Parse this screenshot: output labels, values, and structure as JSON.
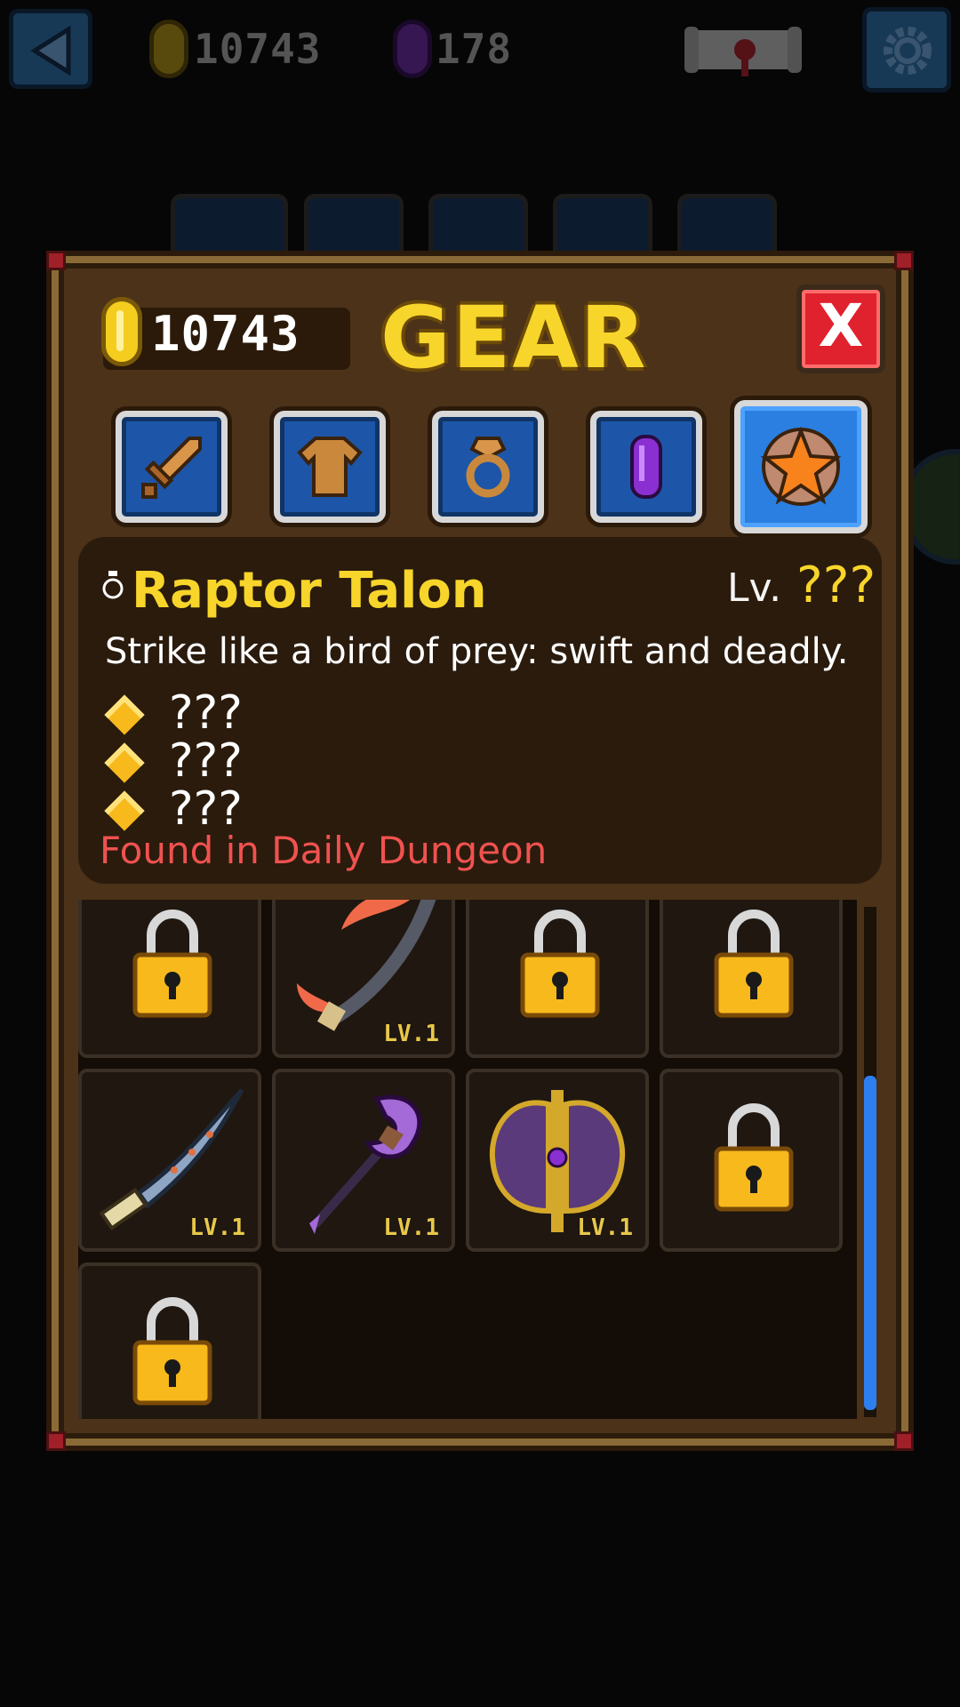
{
  "top_bar": {
    "coins": "10743",
    "gems": "178"
  },
  "gear_panel": {
    "coins": "10743",
    "title": "GEAR",
    "close_label": "X",
    "categories": [
      {
        "name": "weapons",
        "icon": "sword-icon",
        "active": false
      },
      {
        "name": "armor",
        "icon": "shirt-icon",
        "active": false
      },
      {
        "name": "rings",
        "icon": "ring-icon",
        "active": false
      },
      {
        "name": "gems",
        "icon": "gem-icon",
        "active": false
      },
      {
        "name": "special",
        "icon": "star-icon",
        "active": true
      }
    ],
    "item": {
      "name": "Raptor Talon",
      "level_label": "Lv.",
      "level_value": "???",
      "description": "Strike like a bird of prey: swift and deadly.",
      "stats": [
        "???",
        "???",
        "???"
      ],
      "source": "Found in Daily Dungeon"
    },
    "grid": [
      {
        "locked": true,
        "icon": "lock-icon"
      },
      {
        "locked": false,
        "icon": "raptor-talon-icon",
        "level": "LV.1"
      },
      {
        "locked": true,
        "icon": "lock-icon"
      },
      {
        "locked": true,
        "icon": "lock-icon"
      },
      {
        "locked": false,
        "icon": "curved-blade-icon",
        "level": "LV.1"
      },
      {
        "locked": false,
        "icon": "purple-staff-icon",
        "level": "LV.1"
      },
      {
        "locked": false,
        "icon": "double-axe-icon",
        "level": "LV.1"
      },
      {
        "locked": true,
        "icon": "lock-icon"
      },
      {
        "locked": true,
        "icon": "lock-icon"
      }
    ]
  },
  "colors": {
    "gold": "#f8d52a",
    "source_red": "#f0524f",
    "tab_blue": "#1d56a8",
    "panel_brown": "#4b3219"
  }
}
